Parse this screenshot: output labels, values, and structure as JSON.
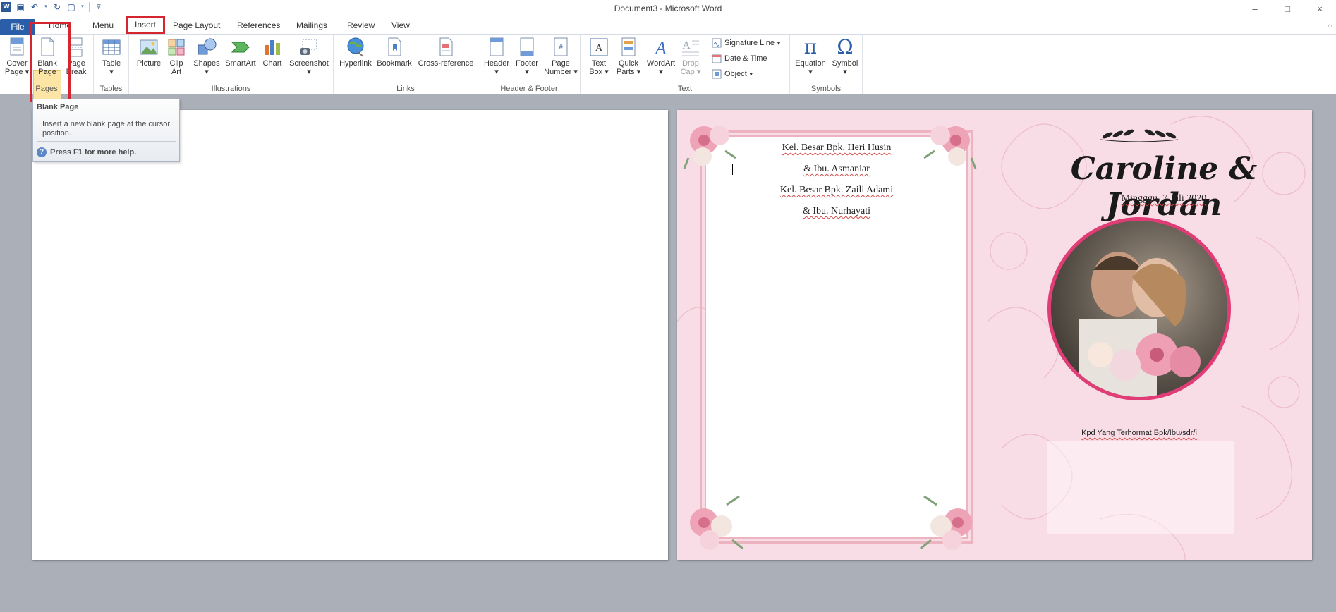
{
  "window": {
    "title": "Document3 - Microsoft Word",
    "controls": [
      "–",
      "□",
      "×"
    ]
  },
  "tabs": {
    "file": "File",
    "items": [
      "Home",
      "Menu",
      "Insert",
      "Page Layout",
      "References",
      "Mailings",
      "Review",
      "View"
    ],
    "active": "Insert"
  },
  "ribbon": {
    "pages": {
      "label": "Pages",
      "cover": "Cover\nPage",
      "blank_1": "Blank",
      "blank_2": "Page",
      "break_1": "Page",
      "break_2": "Break"
    },
    "tables": {
      "label": "Tables",
      "table": "Table"
    },
    "illustrations": {
      "label": "Illustrations",
      "picture": "Picture",
      "clipart_1": "Clip",
      "clipart_2": "Art",
      "shapes": "Shapes",
      "smartart": "SmartArt",
      "chart": "Chart",
      "screenshot": "Screenshot"
    },
    "links": {
      "label": "Links",
      "hyperlink": "Hyperlink",
      "bookmark": "Bookmark",
      "crossref": "Cross-reference"
    },
    "header_footer": {
      "label": "Header & Footer",
      "header": "Header",
      "footer": "Footer",
      "pagenum_1": "Page",
      "pagenum_2": "Number"
    },
    "text": {
      "label": "Text",
      "textbox_1": "Text",
      "textbox_2": "Box",
      "quickparts_1": "Quick",
      "quickparts_2": "Parts",
      "wordart": "WordArt",
      "dropcap_1": "Drop",
      "dropcap_2": "Cap",
      "signature": "Signature Line",
      "datetime": "Date & Time",
      "object": "Object"
    },
    "symbols": {
      "label": "Symbols",
      "equation": "Equation",
      "symbol": "Symbol"
    }
  },
  "tooltip": {
    "title": "Blank Page",
    "description": "Insert a new blank page at the cursor position.",
    "help": "Press F1 for more help."
  },
  "invitation": {
    "family_lines": [
      "Kel. Besar Bpk. Heri Husin",
      "& Ibu. Asmaniar",
      "Kel. Besar Bpk. Zaili Adami",
      "& Ibu. Nurhayati"
    ],
    "couple": "Caroline & Jordan",
    "date": "Mingggu,  7 Juli 2020",
    "recipient": "Kpd Yang Terhormat Bpk/Ibu/sdr/i"
  },
  "colors": {
    "accent_red": "#d5262f",
    "file_tab": "#2b5ea8",
    "page_pink": "#f9dde6",
    "photo_ring": "#e03c76"
  }
}
